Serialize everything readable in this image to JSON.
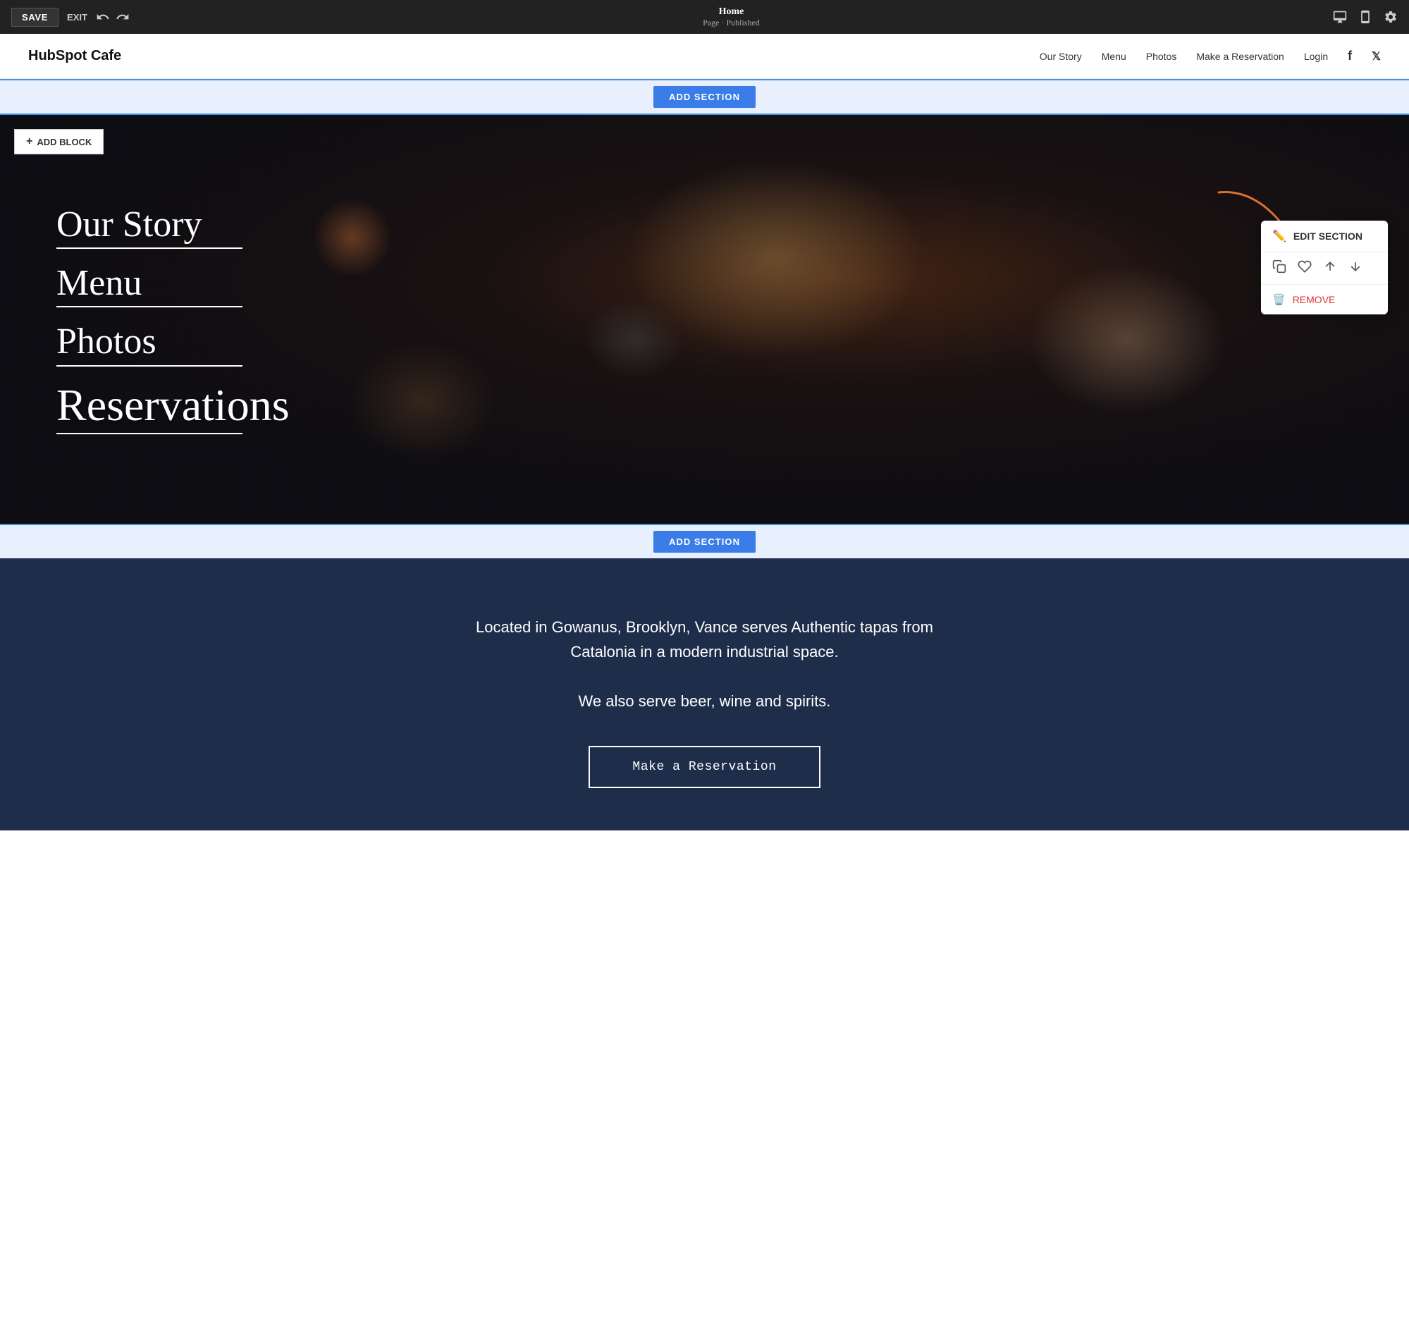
{
  "topbar": {
    "save_label": "SAVE",
    "exit_label": "EXIT",
    "page_name": "Home",
    "page_status": "Page · Published"
  },
  "site": {
    "logo": "HubSpot Cafe",
    "nav": {
      "items": [
        {
          "label": "Our Story",
          "href": "#"
        },
        {
          "label": "Menu",
          "href": "#"
        },
        {
          "label": "Photos",
          "href": "#"
        },
        {
          "label": "Make a Reservation",
          "href": "#"
        },
        {
          "label": "Login",
          "href": "#"
        }
      ],
      "social": [
        {
          "label": "facebook",
          "icon": "f"
        },
        {
          "label": "twitter",
          "icon": "𝕏"
        }
      ]
    }
  },
  "add_section": {
    "label": "ADD SECTION"
  },
  "add_block": {
    "label": "ADD BLOCK"
  },
  "hero": {
    "nav_items": [
      {
        "label": "Our Story"
      },
      {
        "label": "Menu"
      },
      {
        "label": "Photos"
      },
      {
        "label": "Reservations"
      }
    ]
  },
  "context_menu": {
    "edit_label": "EDIT SECTION",
    "remove_label": "REMOVE"
  },
  "info_section": {
    "description": "Located in Gowanus, Brooklyn, Vance serves Authentic tapas from Catalonia in a modern industrial space.",
    "tagline": "We also serve beer, wine and spirits.",
    "cta_label": "Make a Reservation"
  }
}
